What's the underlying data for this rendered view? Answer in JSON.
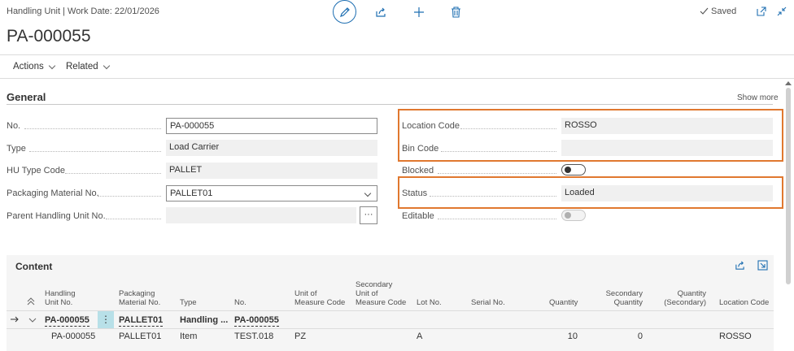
{
  "header": {
    "breadcrumb": "Handling Unit | Work Date: 22/01/2026",
    "title": "PA-000055",
    "saved_label": "Saved"
  },
  "menu": {
    "actions": "Actions",
    "related": "Related"
  },
  "general": {
    "title": "General",
    "show_more": "Show more",
    "left_fields": [
      {
        "label": "No.",
        "value": "PA-000055"
      },
      {
        "label": "Type",
        "value": "Load Carrier"
      },
      {
        "label": "HU Type Code",
        "value": "PALLET"
      },
      {
        "label": "Packaging Material No.",
        "value": "PALLET01"
      },
      {
        "label": "Parent Handling Unit No.",
        "value": ""
      }
    ],
    "right_fields": {
      "location_code": {
        "label": "Location Code",
        "value": "ROSSO"
      },
      "bin_code": {
        "label": "Bin Code",
        "value": ""
      },
      "blocked": {
        "label": "Blocked"
      },
      "status": {
        "label": "Status",
        "value": "Loaded"
      },
      "editable": {
        "label": "Editable"
      }
    },
    "ellipsis": "···",
    "highlight_color": "#e0782f"
  },
  "content": {
    "title": "Content",
    "columns": {
      "hu_no_1": "Handling",
      "hu_no_2": "Unit No.",
      "pm_no_1": "Packaging",
      "pm_no_2": "Material No.",
      "type": "Type",
      "no": "No.",
      "uom_1": "Unit of",
      "uom_2": "Measure Code",
      "suom_1": "Secondary",
      "suom_2": "Unit of",
      "suom_3": "Measure Code",
      "lot": "Lot No.",
      "serial": "Serial No.",
      "qty": "Quantity",
      "sqty_1": "Secondary",
      "sqty_2": "Quantity",
      "qsec_1": "Quantity",
      "qsec_2": "(Secondary)",
      "loc": "Location Code"
    },
    "row1": {
      "hu": "PA-000055",
      "pm": "PALLET01",
      "type": "Handling ...",
      "no": "PA-000055"
    },
    "row2": {
      "hu": "PA-000055",
      "pm": "PALLET01",
      "type": "Item",
      "no": "TEST.018",
      "uom": "PZ",
      "lot": "A",
      "qty": "10",
      "sqty": "0",
      "loc": "ROSSO"
    }
  }
}
